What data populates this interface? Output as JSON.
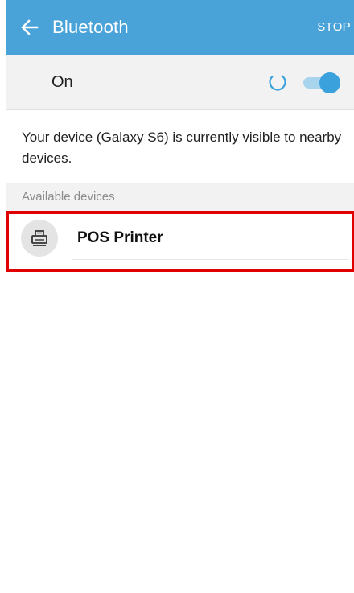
{
  "appbar": {
    "title": "Bluetooth",
    "stop_label": "STOP",
    "back_icon": "arrow-left-icon",
    "background": "#4aa3d8"
  },
  "toggle": {
    "label": "On",
    "state": "on",
    "spinner_icon": "loading-spinner-icon",
    "accent": "#3aa1dc"
  },
  "description": "Your device (Galaxy S6) is currently visible to nearby devices.",
  "available_devices": {
    "header": "Available devices",
    "items": [
      {
        "name": "POS Printer",
        "icon": "printer-icon",
        "highlighted": true
      }
    ]
  },
  "highlight_color": "#e00000"
}
